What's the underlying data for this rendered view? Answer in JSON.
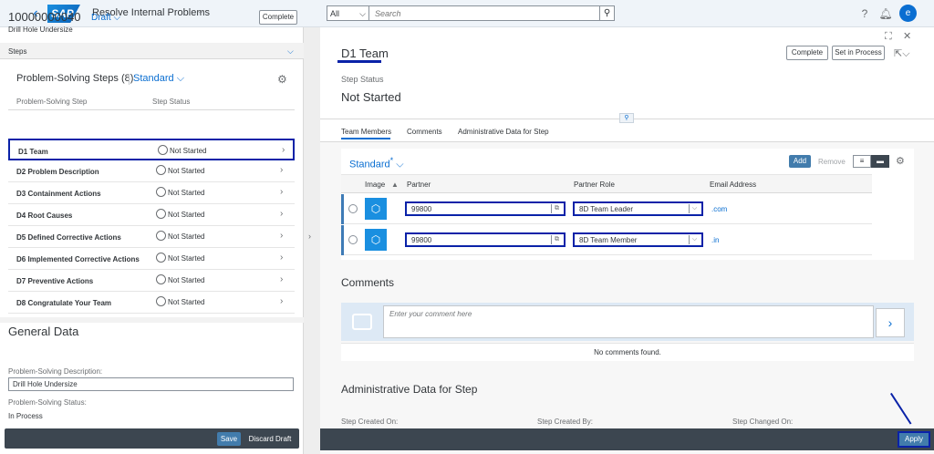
{
  "shell": {
    "app_title": "Resolve Internal Problems",
    "logo": "SAP",
    "search_scope": "All",
    "search_placeholder": "Search",
    "avatar_initial": "e",
    "icons": [
      "help-icon",
      "bell-icon"
    ]
  },
  "left": {
    "object_id": "10000000040",
    "draft_label": "Draft",
    "object_subtitle": "Drill Hole Undersize",
    "complete_label": "Complete",
    "steps_bar_label": "Steps",
    "steps_title": "Problem-Solving Steps (8)",
    "variant": "Standard",
    "col_step": "Problem-Solving Step",
    "col_status": "Step Status",
    "steps": [
      {
        "label": "D1 Team",
        "status": "Not Started"
      },
      {
        "label": "D2 Problem Description",
        "status": "Not Started"
      },
      {
        "label": "D3 Containment Actions",
        "status": "Not Started"
      },
      {
        "label": "D4 Root Causes",
        "status": "Not Started"
      },
      {
        "label": "D5 Defined Corrective Actions",
        "status": "Not Started"
      },
      {
        "label": "D6 Implemented Corrective Actions",
        "status": "Not Started"
      },
      {
        "label": "D7 Preventive Actions",
        "status": "Not Started"
      },
      {
        "label": "D8 Congratulate Your Team",
        "status": "Not Started"
      }
    ],
    "general_title": "General Data",
    "desc_label": "Problem-Solving Description:",
    "desc_value": "Drill Hole Undersize",
    "status_label": "Problem-Solving Status:",
    "status_value": "In Process",
    "save_label": "Save",
    "discard_label": "Discard Draft"
  },
  "right": {
    "title": "D1 Team",
    "step_status_label": "Step Status",
    "step_status_value": "Not Started",
    "complete_label": "Complete",
    "set_in_process_label": "Set in Process",
    "tabs": [
      "Team Members",
      "Comments",
      "Administrative Data for Step"
    ],
    "tm_variant": "Standard",
    "add_label": "Add",
    "remove_label": "Remove",
    "cols": {
      "image": "Image",
      "partner": "Partner",
      "partner_role": "Partner Role",
      "email": "Email Address"
    },
    "members": [
      {
        "partner": "99800",
        "role": "8D Team Leader",
        "email": ".com"
      },
      {
        "partner": "99800",
        "role": "8D Team Member",
        "email": ".in"
      }
    ],
    "comments_title": "Comments",
    "comment_placeholder": "Enter your comment here",
    "no_comments": "No comments found.",
    "admin_title": "Administrative Data for Step",
    "created_on_label": "Step Created On:",
    "created_by_label": "Step Created By:",
    "changed_on_label": "Step Changed On:",
    "apply_label": "Apply"
  }
}
